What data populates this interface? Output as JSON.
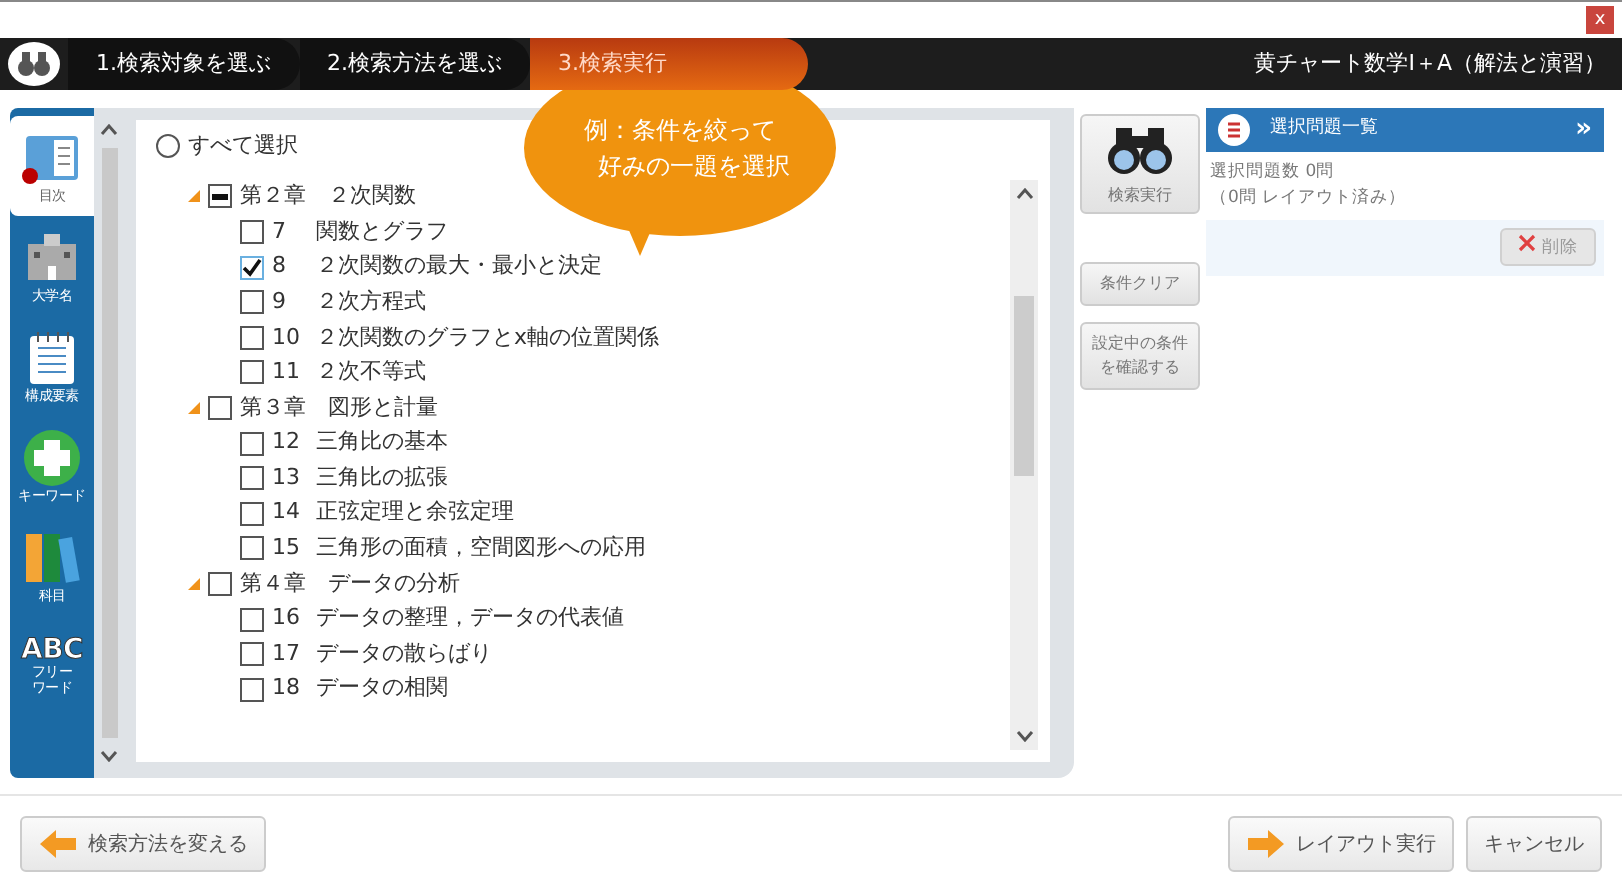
{
  "window": {
    "close": "x"
  },
  "steps": [
    {
      "label": "1.検索対象を選ぶ",
      "selected": false
    },
    {
      "label": "2.検索方法を選ぶ",
      "selected": false
    },
    {
      "label": "3.検索実行",
      "selected": true
    }
  ],
  "book_title": "黄チャート数学Ⅰ＋A（解法と演習）",
  "sidebar": [
    {
      "label": "目次",
      "kind": "book",
      "selected": true
    },
    {
      "label": "大学名",
      "kind": "building",
      "selected": false
    },
    {
      "label": "構成要素",
      "kind": "notepad",
      "selected": false
    },
    {
      "label": "キーワード",
      "kind": "plus",
      "selected": false
    },
    {
      "label": "科目",
      "kind": "books",
      "selected": false
    },
    {
      "label": "フリーワード",
      "kind": "abc",
      "icon_text": "ABC",
      "selected": false
    }
  ],
  "select_all": {
    "label": "すべて選択",
    "selected": false
  },
  "tree": [
    {
      "label": "第２章　２次関数",
      "partial": true,
      "expanded": true,
      "children": [
        {
          "number": "7",
          "label": "関数とグラフ",
          "checked": false
        },
        {
          "number": "8",
          "label": "２次関数の最大・最小と決定",
          "checked": true
        },
        {
          "number": "9",
          "label": "２次方程式",
          "checked": false
        },
        {
          "number": "10",
          "label": "２次関数のグラフとx軸の位置関係",
          "checked": false
        },
        {
          "number": "11",
          "label": "２次不等式",
          "checked": false
        }
      ]
    },
    {
      "label": "第３章　図形と計量",
      "partial": false,
      "expanded": true,
      "children": [
        {
          "number": "12",
          "label": "三角比の基本",
          "checked": false
        },
        {
          "number": "13",
          "label": "三角比の拡張",
          "checked": false
        },
        {
          "number": "14",
          "label": "正弦定理と余弦定理",
          "checked": false
        },
        {
          "number": "15",
          "label": "三角形の面積，空間図形への応用",
          "checked": false
        }
      ]
    },
    {
      "label": "第４章　データの分析",
      "partial": false,
      "expanded": true,
      "children": [
        {
          "number": "16",
          "label": "データの整理，データの代表値",
          "checked": false
        },
        {
          "number": "17",
          "label": "データの散らばり",
          "checked": false
        },
        {
          "number": "18",
          "label": "データの相関",
          "checked": false
        }
      ]
    }
  ],
  "callout": [
    "例：条件を絞って",
    "好みの一題を選択"
  ],
  "actions": [
    {
      "label": "検索実行",
      "kind": "search"
    },
    {
      "label": "条件クリア",
      "kind": "plain"
    },
    {
      "label": "設定中の条件を確認する",
      "kind": "plain"
    }
  ],
  "selection_panel": {
    "title": "選択問題一覧",
    "expand": "»",
    "count": "選択問題数 0問",
    "layout": "（0問 レイアウト済み）",
    "delete_button": {
      "label": "削除",
      "disabled": true
    }
  },
  "footer": {
    "back": "検索方法を変える",
    "run": "レイアウト実行",
    "cancel": "キャンセル"
  }
}
